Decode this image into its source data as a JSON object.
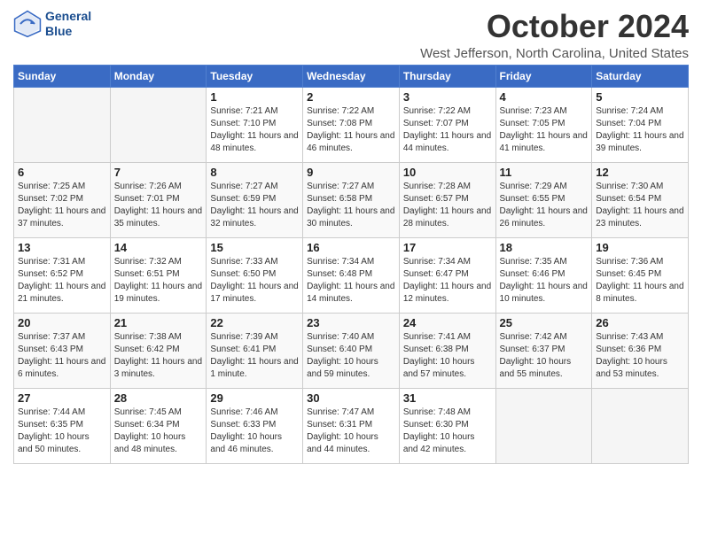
{
  "logo": {
    "line1": "General",
    "line2": "Blue"
  },
  "title": "October 2024",
  "location": "West Jefferson, North Carolina, United States",
  "days_of_week": [
    "Sunday",
    "Monday",
    "Tuesday",
    "Wednesday",
    "Thursday",
    "Friday",
    "Saturday"
  ],
  "weeks": [
    [
      {
        "num": "",
        "info": ""
      },
      {
        "num": "",
        "info": ""
      },
      {
        "num": "1",
        "info": "Sunrise: 7:21 AM\nSunset: 7:10 PM\nDaylight: 11 hours and 48 minutes."
      },
      {
        "num": "2",
        "info": "Sunrise: 7:22 AM\nSunset: 7:08 PM\nDaylight: 11 hours and 46 minutes."
      },
      {
        "num": "3",
        "info": "Sunrise: 7:22 AM\nSunset: 7:07 PM\nDaylight: 11 hours and 44 minutes."
      },
      {
        "num": "4",
        "info": "Sunrise: 7:23 AM\nSunset: 7:05 PM\nDaylight: 11 hours and 41 minutes."
      },
      {
        "num": "5",
        "info": "Sunrise: 7:24 AM\nSunset: 7:04 PM\nDaylight: 11 hours and 39 minutes."
      }
    ],
    [
      {
        "num": "6",
        "info": "Sunrise: 7:25 AM\nSunset: 7:02 PM\nDaylight: 11 hours and 37 minutes."
      },
      {
        "num": "7",
        "info": "Sunrise: 7:26 AM\nSunset: 7:01 PM\nDaylight: 11 hours and 35 minutes."
      },
      {
        "num": "8",
        "info": "Sunrise: 7:27 AM\nSunset: 6:59 PM\nDaylight: 11 hours and 32 minutes."
      },
      {
        "num": "9",
        "info": "Sunrise: 7:27 AM\nSunset: 6:58 PM\nDaylight: 11 hours and 30 minutes."
      },
      {
        "num": "10",
        "info": "Sunrise: 7:28 AM\nSunset: 6:57 PM\nDaylight: 11 hours and 28 minutes."
      },
      {
        "num": "11",
        "info": "Sunrise: 7:29 AM\nSunset: 6:55 PM\nDaylight: 11 hours and 26 minutes."
      },
      {
        "num": "12",
        "info": "Sunrise: 7:30 AM\nSunset: 6:54 PM\nDaylight: 11 hours and 23 minutes."
      }
    ],
    [
      {
        "num": "13",
        "info": "Sunrise: 7:31 AM\nSunset: 6:52 PM\nDaylight: 11 hours and 21 minutes."
      },
      {
        "num": "14",
        "info": "Sunrise: 7:32 AM\nSunset: 6:51 PM\nDaylight: 11 hours and 19 minutes."
      },
      {
        "num": "15",
        "info": "Sunrise: 7:33 AM\nSunset: 6:50 PM\nDaylight: 11 hours and 17 minutes."
      },
      {
        "num": "16",
        "info": "Sunrise: 7:34 AM\nSunset: 6:48 PM\nDaylight: 11 hours and 14 minutes."
      },
      {
        "num": "17",
        "info": "Sunrise: 7:34 AM\nSunset: 6:47 PM\nDaylight: 11 hours and 12 minutes."
      },
      {
        "num": "18",
        "info": "Sunrise: 7:35 AM\nSunset: 6:46 PM\nDaylight: 11 hours and 10 minutes."
      },
      {
        "num": "19",
        "info": "Sunrise: 7:36 AM\nSunset: 6:45 PM\nDaylight: 11 hours and 8 minutes."
      }
    ],
    [
      {
        "num": "20",
        "info": "Sunrise: 7:37 AM\nSunset: 6:43 PM\nDaylight: 11 hours and 6 minutes."
      },
      {
        "num": "21",
        "info": "Sunrise: 7:38 AM\nSunset: 6:42 PM\nDaylight: 11 hours and 3 minutes."
      },
      {
        "num": "22",
        "info": "Sunrise: 7:39 AM\nSunset: 6:41 PM\nDaylight: 11 hours and 1 minute."
      },
      {
        "num": "23",
        "info": "Sunrise: 7:40 AM\nSunset: 6:40 PM\nDaylight: 10 hours and 59 minutes."
      },
      {
        "num": "24",
        "info": "Sunrise: 7:41 AM\nSunset: 6:38 PM\nDaylight: 10 hours and 57 minutes."
      },
      {
        "num": "25",
        "info": "Sunrise: 7:42 AM\nSunset: 6:37 PM\nDaylight: 10 hours and 55 minutes."
      },
      {
        "num": "26",
        "info": "Sunrise: 7:43 AM\nSunset: 6:36 PM\nDaylight: 10 hours and 53 minutes."
      }
    ],
    [
      {
        "num": "27",
        "info": "Sunrise: 7:44 AM\nSunset: 6:35 PM\nDaylight: 10 hours and 50 minutes."
      },
      {
        "num": "28",
        "info": "Sunrise: 7:45 AM\nSunset: 6:34 PM\nDaylight: 10 hours and 48 minutes."
      },
      {
        "num": "29",
        "info": "Sunrise: 7:46 AM\nSunset: 6:33 PM\nDaylight: 10 hours and 46 minutes."
      },
      {
        "num": "30",
        "info": "Sunrise: 7:47 AM\nSunset: 6:31 PM\nDaylight: 10 hours and 44 minutes."
      },
      {
        "num": "31",
        "info": "Sunrise: 7:48 AM\nSunset: 6:30 PM\nDaylight: 10 hours and 42 minutes."
      },
      {
        "num": "",
        "info": ""
      },
      {
        "num": "",
        "info": ""
      }
    ]
  ]
}
